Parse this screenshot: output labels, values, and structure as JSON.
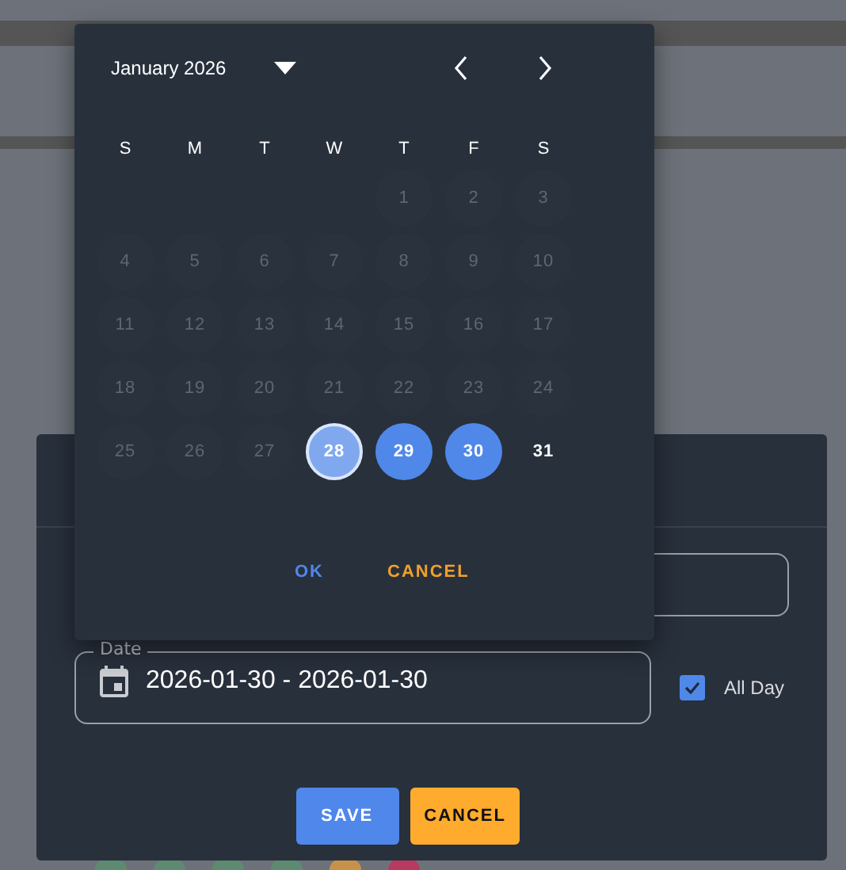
{
  "background": {
    "dots": [
      {
        "color": "#5e8a72"
      },
      {
        "color": "#5e8a72"
      },
      {
        "color": "#5e8a72"
      },
      {
        "color": "#5e8a72"
      },
      {
        "color": "#c8914a"
      },
      {
        "color": "#b83a5e"
      }
    ]
  },
  "dialog": {
    "date_field": {
      "label": "Date",
      "value": "2026-01-30 - 2026-01-30"
    },
    "all_day": {
      "label": "All Day",
      "checked": true
    },
    "buttons": [
      {
        "kind": "primary",
        "label": "SAVE"
      },
      {
        "kind": "warning",
        "label": "CANCEL"
      }
    ]
  },
  "date_picker": {
    "month": "January 2026",
    "weekdays": [
      "S",
      "M",
      "T",
      "W",
      "T",
      "F",
      "S"
    ],
    "days": [
      {
        "label": "1",
        "disabled": true,
        "selected": false,
        "range_start": false
      },
      {
        "label": "2",
        "disabled": true,
        "selected": false,
        "range_start": false
      },
      {
        "label": "3",
        "disabled": true,
        "selected": false,
        "range_start": false
      },
      {
        "label": "4",
        "disabled": true,
        "selected": false,
        "range_start": false
      },
      {
        "label": "5",
        "disabled": true,
        "selected": false,
        "range_start": false
      },
      {
        "label": "6",
        "disabled": true,
        "selected": false,
        "range_start": false
      },
      {
        "label": "7",
        "disabled": true,
        "selected": false,
        "range_start": false
      },
      {
        "label": "8",
        "disabled": true,
        "selected": false,
        "range_start": false
      },
      {
        "label": "9",
        "disabled": true,
        "selected": false,
        "range_start": false
      },
      {
        "label": "10",
        "disabled": true,
        "selected": false,
        "range_start": false
      },
      {
        "label": "11",
        "disabled": true,
        "selected": false,
        "range_start": false
      },
      {
        "label": "12",
        "disabled": true,
        "selected": false,
        "range_start": false
      },
      {
        "label": "13",
        "disabled": true,
        "selected": false,
        "range_start": false
      },
      {
        "label": "14",
        "disabled": true,
        "selected": false,
        "range_start": false
      },
      {
        "label": "15",
        "disabled": true,
        "selected": false,
        "range_start": false
      },
      {
        "label": "16",
        "disabled": true,
        "selected": false,
        "range_start": false
      },
      {
        "label": "17",
        "disabled": true,
        "selected": false,
        "range_start": false
      },
      {
        "label": "18",
        "disabled": true,
        "selected": false,
        "range_start": false
      },
      {
        "label": "19",
        "disabled": true,
        "selected": false,
        "range_start": false
      },
      {
        "label": "20",
        "disabled": true,
        "selected": false,
        "range_start": false
      },
      {
        "label": "21",
        "disabled": true,
        "selected": false,
        "range_start": false
      },
      {
        "label": "22",
        "disabled": true,
        "selected": false,
        "range_start": false
      },
      {
        "label": "23",
        "disabled": true,
        "selected": false,
        "range_start": false
      },
      {
        "label": "24",
        "disabled": true,
        "selected": false,
        "range_start": false
      },
      {
        "label": "25",
        "disabled": true,
        "selected": false,
        "range_start": false
      },
      {
        "label": "26",
        "disabled": true,
        "selected": false,
        "range_start": false
      },
      {
        "label": "27",
        "disabled": true,
        "selected": false,
        "range_start": false
      },
      {
        "label": "28",
        "disabled": false,
        "selected": true,
        "range_start": true
      },
      {
        "label": "29",
        "disabled": false,
        "selected": true,
        "range_start": false
      },
      {
        "label": "30",
        "disabled": false,
        "selected": true,
        "range_start": false
      },
      {
        "label": "31",
        "disabled": false,
        "selected": false,
        "range_start": false
      }
    ],
    "actions": [
      {
        "kind": "ok",
        "label": "OK"
      },
      {
        "kind": "cancel",
        "label": "CANCEL"
      }
    ]
  }
}
